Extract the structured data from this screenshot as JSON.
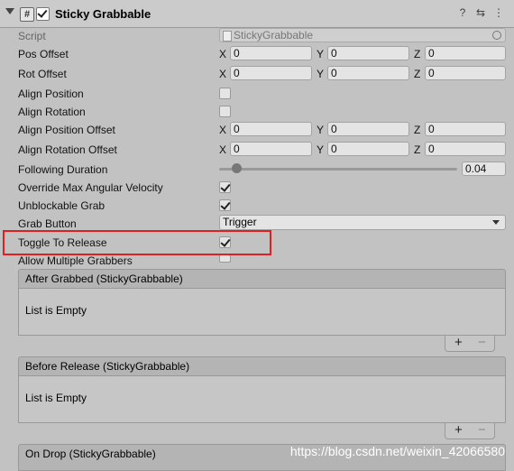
{
  "component": {
    "title": "Sticky Grabbable"
  },
  "script_field": {
    "label": "Script",
    "value": "StickyGrabbable"
  },
  "vectors": [
    {
      "label": "Pos Offset",
      "x": "0",
      "y": "0",
      "z": "0"
    },
    {
      "label": "Rot Offset",
      "x": "0",
      "y": "0",
      "z": "0"
    }
  ],
  "align_position": {
    "label": "Align Position",
    "checked": false
  },
  "align_rotation": {
    "label": "Align Rotation",
    "checked": false
  },
  "vectors2": [
    {
      "label": "Align Position Offset",
      "x": "0",
      "y": "0",
      "z": "0"
    },
    {
      "label": "Align Rotation Offset",
      "x": "0",
      "y": "0",
      "z": "0"
    }
  ],
  "axis": {
    "x": "X",
    "y": "Y",
    "z": "Z"
  },
  "following_duration": {
    "label": "Following Duration",
    "value": "0.04",
    "fraction": 0.04
  },
  "override_max": {
    "label": "Override Max Angular Velocity",
    "checked": true
  },
  "unblockable": {
    "label": "Unblockable Grab",
    "checked": true
  },
  "grab_button": {
    "label": "Grab Button",
    "value": "Trigger"
  },
  "toggle_release": {
    "label": "Toggle To Release",
    "checked": true
  },
  "allow_multiple": {
    "label": "Allow Multiple Grabbers",
    "checked": false
  },
  "events": [
    {
      "title": "After Grabbed (StickyGrabbable)",
      "empty": "List is Empty",
      "plus": "+",
      "minus": "−"
    },
    {
      "title": "Before Release (StickyGrabbable)",
      "empty": "List is Empty",
      "plus": "+",
      "minus": "−"
    },
    {
      "title": "On Drop (StickyGrabbable)"
    }
  ],
  "header_icons": {
    "help": "?",
    "preset": "⇆",
    "menu": "⋮"
  },
  "watermark": "https://blog.csdn.net/weixin_42066580",
  "colors": {
    "highlight": "#e02020"
  }
}
